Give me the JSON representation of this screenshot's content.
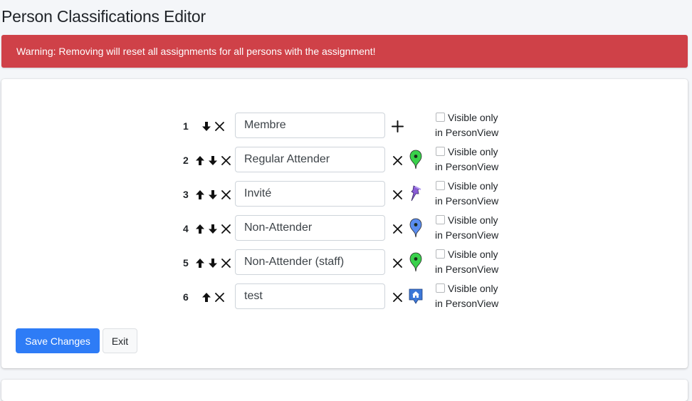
{
  "title": "Person Classifications Editor",
  "alert": {
    "text": "Warning: Removing will reset all assignments for all persons with the assignment!",
    "color": "#cf4148"
  },
  "visible_label_line1": "Visible only",
  "visible_label_line2": "in PersonView",
  "rows": [
    {
      "index": "1",
      "value": "Membre",
      "has_up": false,
      "has_down": true,
      "action": "add-icon",
      "icon": null,
      "visible_only": false
    },
    {
      "index": "2",
      "value": "Regular Attender",
      "has_up": true,
      "has_down": true,
      "action": "remove-icon",
      "icon": "green-map-pin-icon",
      "visible_only": false
    },
    {
      "index": "3",
      "value": "Invité",
      "has_up": true,
      "has_down": true,
      "action": "remove-icon",
      "icon": "purple-pushpin-icon",
      "visible_only": false
    },
    {
      "index": "4",
      "value": "Non-Attender",
      "has_up": true,
      "has_down": true,
      "action": "remove-icon",
      "icon": "blue-map-pin-icon",
      "visible_only": false
    },
    {
      "index": "5",
      "value": "Non-Attender (staff)",
      "has_up": true,
      "has_down": true,
      "action": "remove-icon",
      "icon": "green-map-pin-icon",
      "visible_only": false
    },
    {
      "index": "6",
      "value": "test",
      "has_up": true,
      "has_down": false,
      "action": "remove-icon",
      "icon": "blue-house-marker-icon",
      "visible_only": false
    }
  ],
  "buttons": {
    "save": "Save Changes",
    "exit": "Exit"
  },
  "colors": {
    "primary": "#2e7cf6",
    "pin_green": "#39d14b",
    "pin_blue": "#5a8df0",
    "pin_purple": "#8a5cd6"
  }
}
